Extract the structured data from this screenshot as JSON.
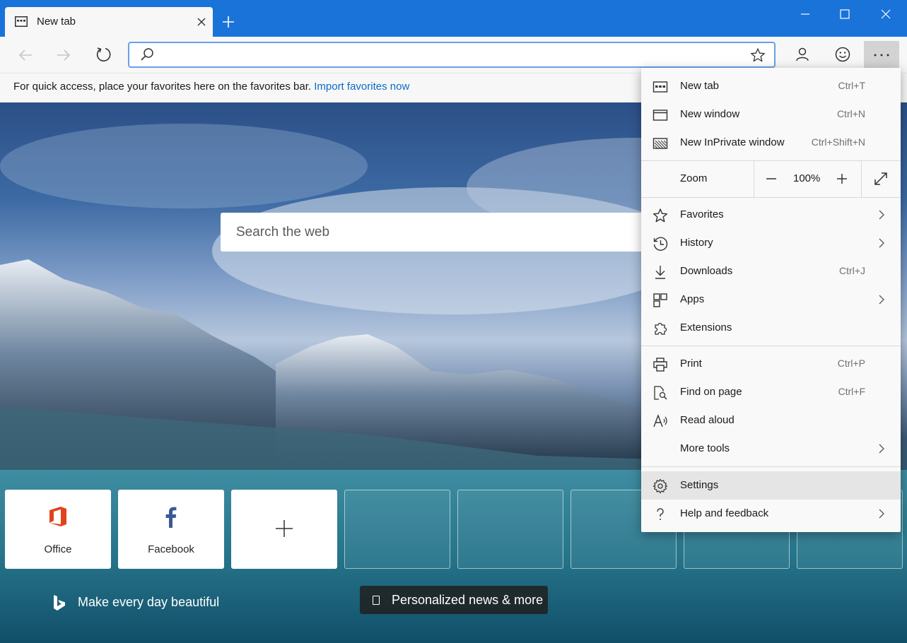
{
  "tab": {
    "title": "New tab"
  },
  "address": {
    "value": ""
  },
  "favorites_bar": {
    "text": "For quick access, place your favorites here on the favorites bar.",
    "link": "Import favorites now"
  },
  "search": {
    "placeholder": "Search the web"
  },
  "tiles": [
    {
      "label": "Office"
    },
    {
      "label": "Facebook"
    },
    {
      "label": ""
    }
  ],
  "bing": {
    "tagline": "Make every day beautiful"
  },
  "news": {
    "label": "Personalized news & more"
  },
  "menu": {
    "new_tab": {
      "label": "New tab",
      "shortcut": "Ctrl+T"
    },
    "new_window": {
      "label": "New window",
      "shortcut": "Ctrl+N"
    },
    "new_inprivate": {
      "label": "New InPrivate window",
      "shortcut": "Ctrl+Shift+N"
    },
    "zoom": {
      "label": "Zoom",
      "value": "100%"
    },
    "favorites": {
      "label": "Favorites"
    },
    "history": {
      "label": "History"
    },
    "downloads": {
      "label": "Downloads",
      "shortcut": "Ctrl+J"
    },
    "apps": {
      "label": "Apps"
    },
    "extensions": {
      "label": "Extensions"
    },
    "print": {
      "label": "Print",
      "shortcut": "Ctrl+P"
    },
    "find_on_page": {
      "label": "Find on page",
      "shortcut": "Ctrl+F"
    },
    "read_aloud": {
      "label": "Read aloud"
    },
    "more_tools": {
      "label": "More tools"
    },
    "settings": {
      "label": "Settings"
    },
    "help": {
      "label": "Help and feedback"
    }
  },
  "colors": {
    "titlebar": "#1a73d9",
    "link": "#0a6bc8",
    "office": "#e2431e",
    "facebook": "#3b5998"
  }
}
